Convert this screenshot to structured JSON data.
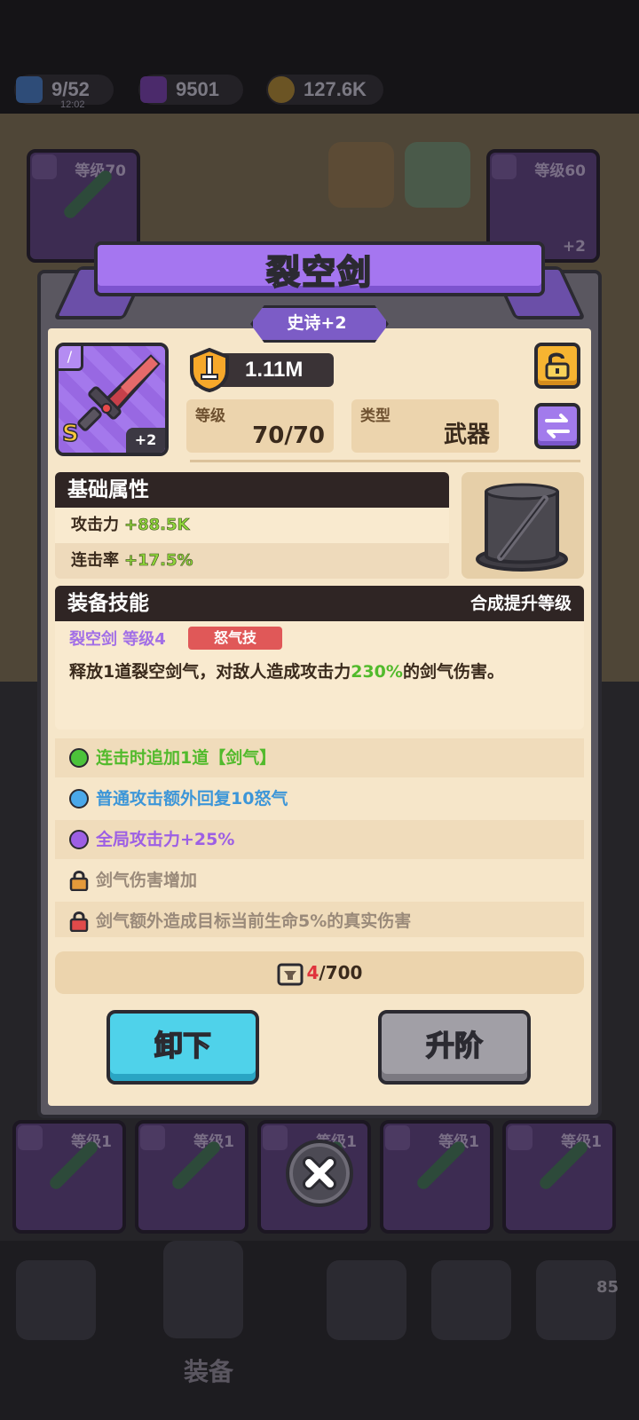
{
  "resources": {
    "energy": "9/52",
    "energy_timer": "12:02",
    "gems": "9501",
    "gold": "127.6K"
  },
  "background": {
    "slot_top_left_level": "等级70",
    "slot_top_right_level": "等级60",
    "slot_top_right_plus": "+2",
    "bottom_slots": [
      "等级1",
      "等级1",
      "等级1",
      "等级1",
      "等级1"
    ],
    "nav_active_label": "装备",
    "nav_badge_count": "85"
  },
  "modal": {
    "title": "裂空剑",
    "rarity": "史诗+2",
    "item": {
      "grade": "S",
      "plus": "+2",
      "icon": "sword-icon"
    },
    "power": "1.11M",
    "level_label": "等级",
    "level_value": "70/70",
    "type_label": "类型",
    "type_value": "武器",
    "base_stats": {
      "title": "基础属性",
      "rows": [
        {
          "name": "攻击力",
          "value": "+88.5K"
        },
        {
          "name": "连击率",
          "value": "+17.5%"
        }
      ]
    },
    "skill": {
      "title": "装备技能",
      "right_label": "合成提升等级",
      "name": "裂空剑 等级4",
      "tag": "怒气技",
      "desc_before": "释放1道裂空剑气，对敌人造成攻击力",
      "desc_highlight": "230%",
      "desc_after": "的剑气伤害。"
    },
    "perks": [
      {
        "text": "连击时追加1道【剑气】",
        "state": "unlocked",
        "color": "#52ba2c",
        "dot": "#4cc33a"
      },
      {
        "text": "普通攻击额外回复10怒气",
        "state": "unlocked",
        "color": "#3d96d8",
        "dot": "#4aa8ea"
      },
      {
        "text": "全局攻击力+25%",
        "state": "unlocked",
        "color": "#9d5fe4",
        "dot": "#9d5fe4"
      },
      {
        "text": "剑气伤害增加",
        "state": "locked",
        "color": "#9a8a7a",
        "lock": "#e59a3a"
      },
      {
        "text": "剑气额外造成目标当前生命5%的真实伤害",
        "state": "locked",
        "color": "#9a8a7a",
        "lock": "#e04a4a"
      }
    ],
    "fragments": {
      "have": "4",
      "need": "/700"
    },
    "unequip_label": "卸下",
    "upgrade_label": "升阶"
  },
  "colors": {
    "purple": "#a576f0",
    "blue_button": "#4fd2ea",
    "gray_button": "#a19fa6",
    "panel": "#f6e6c9"
  }
}
